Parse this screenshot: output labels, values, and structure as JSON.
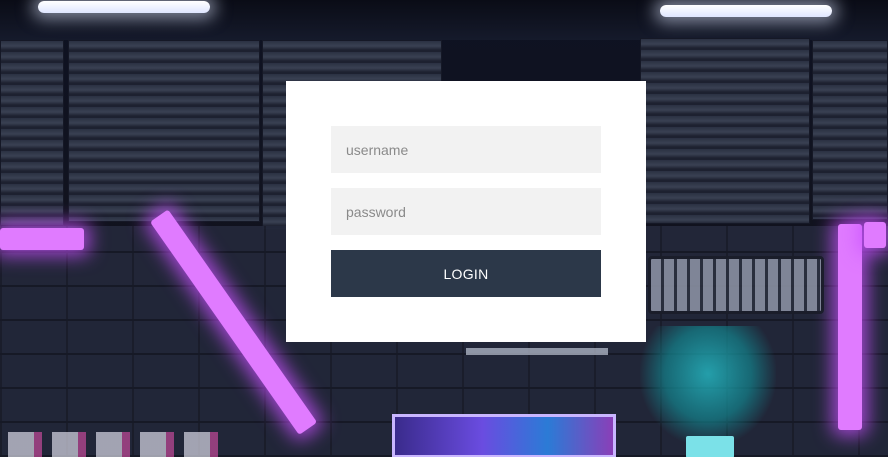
{
  "login_form": {
    "username_placeholder": "username",
    "username_value": "",
    "password_placeholder": "password",
    "password_value": "",
    "login_label": "LOGIN"
  },
  "colors": {
    "card_background": "#ffffff",
    "input_background": "#f2f2f2",
    "button_background": "#2c3849",
    "button_text": "#ffffff",
    "neon_accent": "#e07bff"
  }
}
